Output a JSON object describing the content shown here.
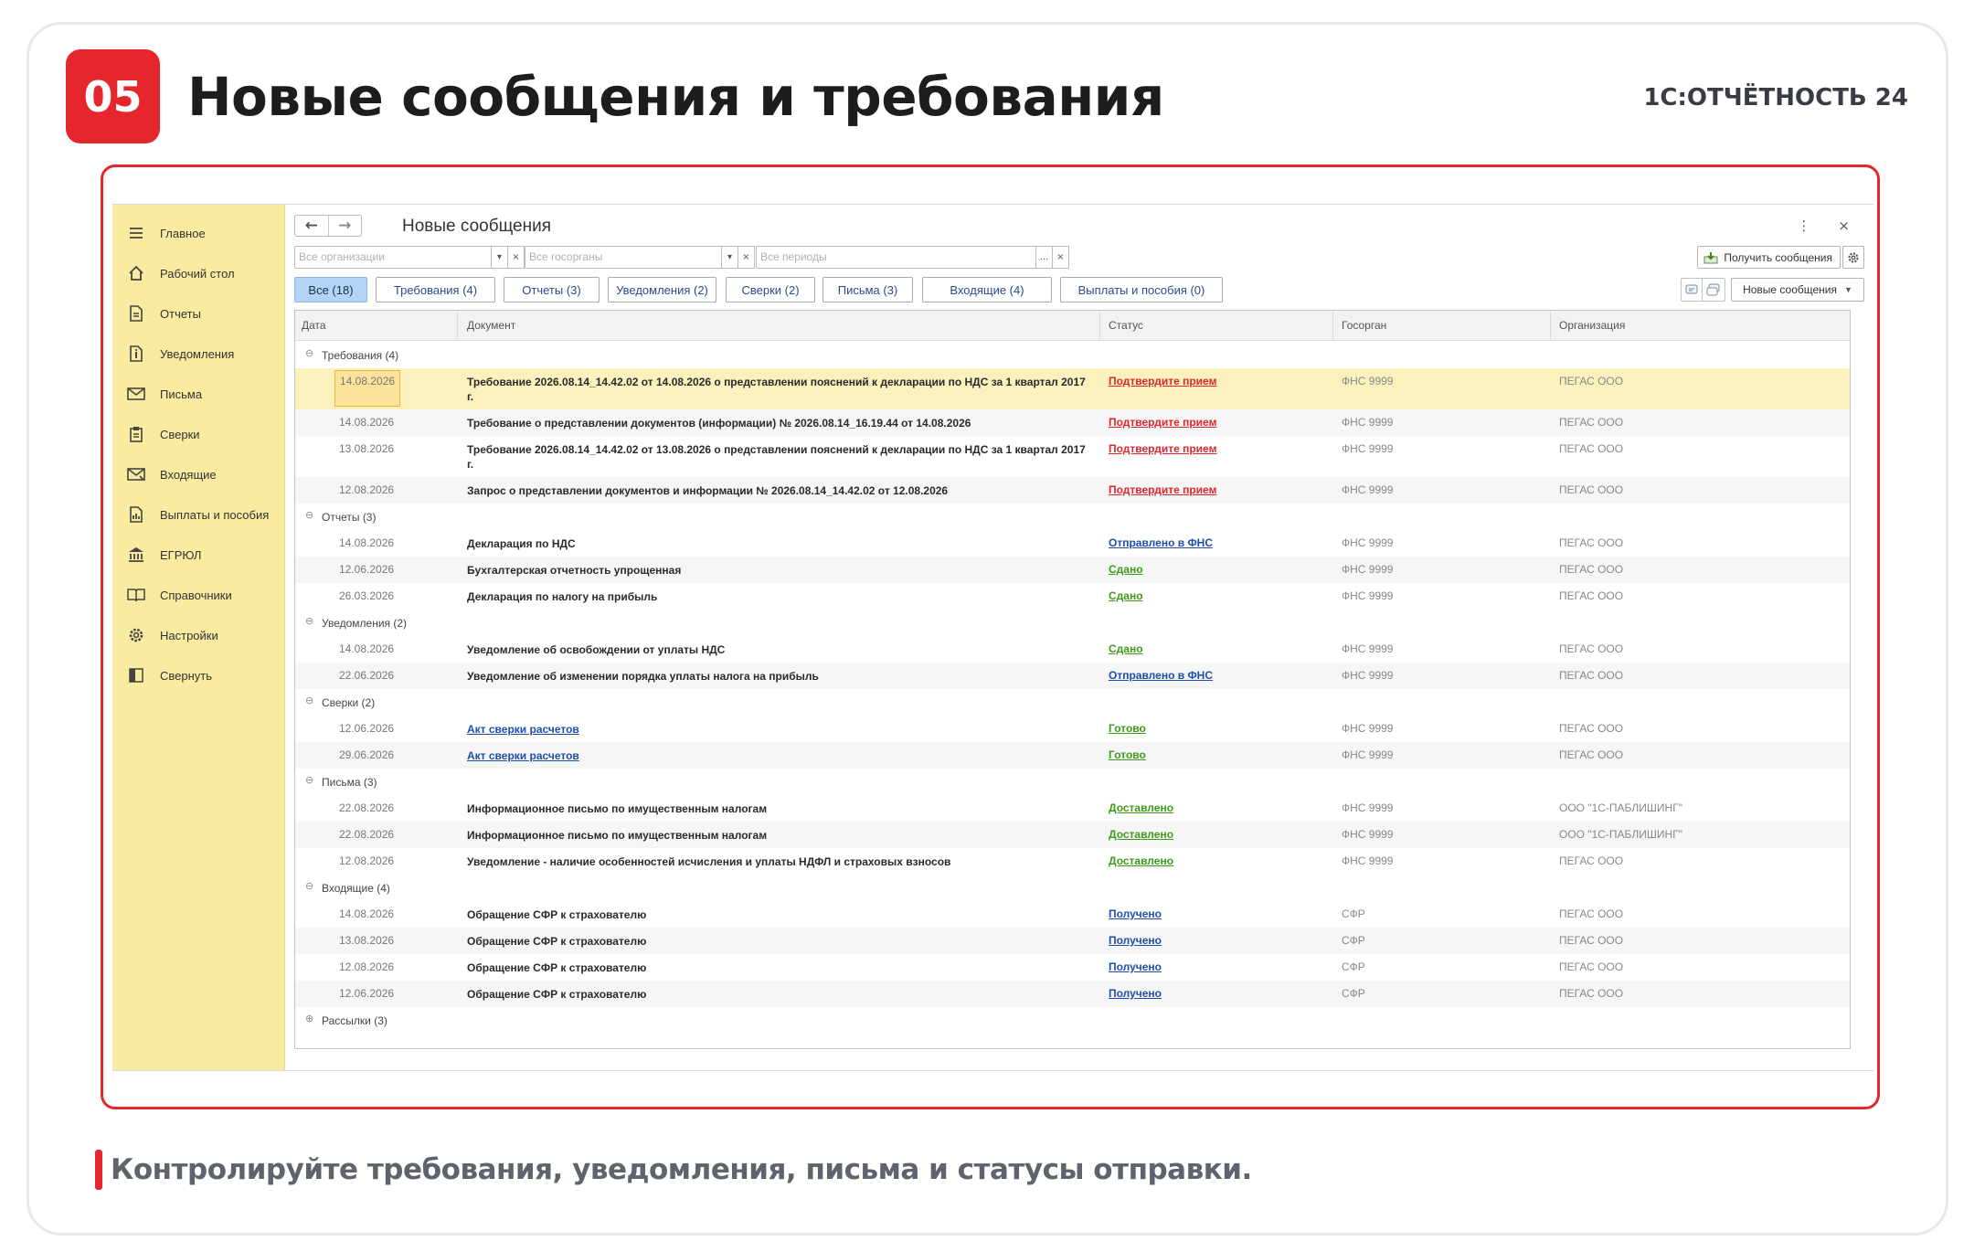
{
  "slide": {
    "number": "05",
    "title": "Новые сообщения и требования",
    "brand": "1С:ОТЧЁТНОСТЬ 24",
    "caption": "Контролируйте требования, уведомления, письма и статусы отправки.",
    "accent_color": "#e5262d"
  },
  "sidebar": {
    "items": [
      {
        "label": "Главное",
        "icon": "menu-icon"
      },
      {
        "label": "Рабочий стол",
        "icon": "home-icon"
      },
      {
        "label": "Отчеты",
        "icon": "document-icon"
      },
      {
        "label": "Уведомления",
        "icon": "info-document-icon"
      },
      {
        "label": "Письма",
        "icon": "mail-icon"
      },
      {
        "label": "Сверки",
        "icon": "clipboard-icon"
      },
      {
        "label": "Входящие",
        "icon": "inbox-mail-icon"
      },
      {
        "label": "Выплаты и пособия",
        "icon": "payments-document-icon"
      },
      {
        "label": "ЕГРЮЛ",
        "icon": "bank-icon"
      },
      {
        "label": "Справочники",
        "icon": "book-icon"
      },
      {
        "label": "Настройки",
        "icon": "gear-icon"
      },
      {
        "label": "Свернуть",
        "icon": "collapse-panel-icon"
      }
    ]
  },
  "form": {
    "title": "Новые сообщения",
    "filters": {
      "organization_placeholder": "Все организации",
      "agency_placeholder": "Все госорганы",
      "period_placeholder": "Все периоды"
    },
    "get_messages_label": "Получить сообщения",
    "sort_label": "Новые сообщения",
    "tabs": [
      "Все (18)",
      "Требования (4)",
      "Отчеты (3)",
      "Уведомления (2)",
      "Сверки (2)",
      "Письма (3)",
      "Входящие (4)",
      "Выплаты и пособия (0)"
    ]
  },
  "grid": {
    "columns": [
      "Дата",
      "Документ",
      "Статус",
      "Госорган",
      "Организация"
    ],
    "groups": [
      {
        "name": "Требования (4)",
        "rows": [
          {
            "date": "14.08.2026",
            "doc": "Требование 2026.08.14_14.42.02 от 14.08.2026 о представлении пояснений к декларации по НДС за 1 квартал 2017 г.",
            "status": "Подтвердите прием",
            "status_color": "#e0262d",
            "agency": "ФНС 9999",
            "org": "ПЕГАС ООО",
            "selected": true
          },
          {
            "date": "14.08.2026",
            "doc": "Требование о представлении документов (информации) № 2026.08.14_16.19.44 от 14.08.2026",
            "status": "Подтвердите прием",
            "status_color": "#e0262d",
            "agency": "ФНС 9999",
            "org": "ПЕГАС ООО"
          },
          {
            "date": "13.08.2026",
            "doc": "Требование 2026.08.14_14.42.02 от 13.08.2026 о представлении пояснений к декларации по НДС за 1 квартал 2017 г.",
            "status": "Подтвердите прием",
            "status_color": "#e0262d",
            "agency": "ФНС 9999",
            "org": "ПЕГАС ООО"
          },
          {
            "date": "12.08.2026",
            "doc": "Запрос о представлении документов и информации № 2026.08.14_14.42.02 от 12.08.2026",
            "status": "Подтвердите прием",
            "status_color": "#e0262d",
            "agency": "ФНС 9999",
            "org": "ПЕГАС ООО"
          }
        ]
      },
      {
        "name": "Отчеты (3)",
        "rows": [
          {
            "date": "14.08.2026",
            "doc": "Декларация по НДС",
            "status": "Отправлено в ФНС",
            "status_color": "#1e4fa8",
            "agency": "ФНС 9999",
            "org": "ПЕГАС ООО"
          },
          {
            "date": "12.06.2026",
            "doc": "Бухгалтерская отчетность упрощенная",
            "status": "Сдано",
            "status_color": "#3f9a1a",
            "agency": "ФНС 9999",
            "org": "ПЕГАС ООО"
          },
          {
            "date": "26.03.2026",
            "doc": "Декларация по налогу на прибыль",
            "status": "Сдано",
            "status_color": "#3f9a1a",
            "agency": "ФНС 9999",
            "org": "ПЕГАС ООО"
          }
        ]
      },
      {
        "name": "Уведомления (2)",
        "rows": [
          {
            "date": "14.08.2026",
            "doc": "Уведомление об освобождении от уплаты НДС",
            "status": "Сдано",
            "status_color": "#3f9a1a",
            "agency": "ФНС 9999",
            "org": "ПЕГАС ООО"
          },
          {
            "date": "22.06.2026",
            "doc": "Уведомление об изменении порядка уплаты налога на прибыль",
            "status": "Отправлено в ФНС",
            "status_color": "#1e4fa8",
            "agency": "ФНС 9999",
            "org": "ПЕГАС ООО"
          }
        ]
      },
      {
        "name": "Сверки (2)",
        "rows": [
          {
            "date": "12.06.2026",
            "doc": "Акт сверки расчетов",
            "doc_link": true,
            "status": "Готово",
            "status_color": "#3f9a1a",
            "agency": "ФНС 9999",
            "org": "ПЕГАС ООО"
          },
          {
            "date": "29.06.2026",
            "doc": "Акт сверки расчетов",
            "doc_link": true,
            "status": "Готово",
            "status_color": "#3f9a1a",
            "agency": "ФНС 9999",
            "org": "ПЕГАС ООО"
          }
        ]
      },
      {
        "name": "Письма (3)",
        "rows": [
          {
            "date": "22.08.2026",
            "doc": "Информационное письмо по имущественным налогам",
            "status": "Доставлено",
            "status_color": "#3f9a1a",
            "agency": "ФНС 9999",
            "org": "ООО \"1С-ПАБЛИШИНГ\""
          },
          {
            "date": "22.08.2026",
            "doc": "Информационное письмо по имущественным налогам",
            "status": "Доставлено",
            "status_color": "#3f9a1a",
            "agency": "ФНС 9999",
            "org": "ООО \"1С-ПАБЛИШИНГ\""
          },
          {
            "date": "12.08.2026",
            "doc": "Уведомление - наличие особенностей исчисления и уплаты НДФЛ и страховых взносов",
            "status": "Доставлено",
            "status_color": "#3f9a1a",
            "agency": "ФНС 9999",
            "org": "ПЕГАС ООО"
          }
        ]
      },
      {
        "name": "Входящие (4)",
        "rows": [
          {
            "date": "14.08.2026",
            "doc": "Обращение СФР к страхователю",
            "status": "Получено",
            "status_color": "#1e4fa8",
            "agency": "СФР",
            "org": "ПЕГАС ООО"
          },
          {
            "date": "13.08.2026",
            "doc": "Обращение СФР к страхователю",
            "status": "Получено",
            "status_color": "#1e4fa8",
            "agency": "СФР",
            "org": "ПЕГАС ООО"
          },
          {
            "date": "12.08.2026",
            "doc": "Обращение СФР к страхователю",
            "status": "Получено",
            "status_color": "#1e4fa8",
            "agency": "СФР",
            "org": "ПЕГАС ООО"
          },
          {
            "date": "12.06.2026",
            "doc": "Обращение СФР к страхователю",
            "status": "Получено",
            "status_color": "#1e4fa8",
            "agency": "СФР",
            "org": "ПЕГАС ООО"
          }
        ]
      },
      {
        "name": "Рассылки (3)",
        "collapsed": true,
        "rows": []
      }
    ]
  }
}
